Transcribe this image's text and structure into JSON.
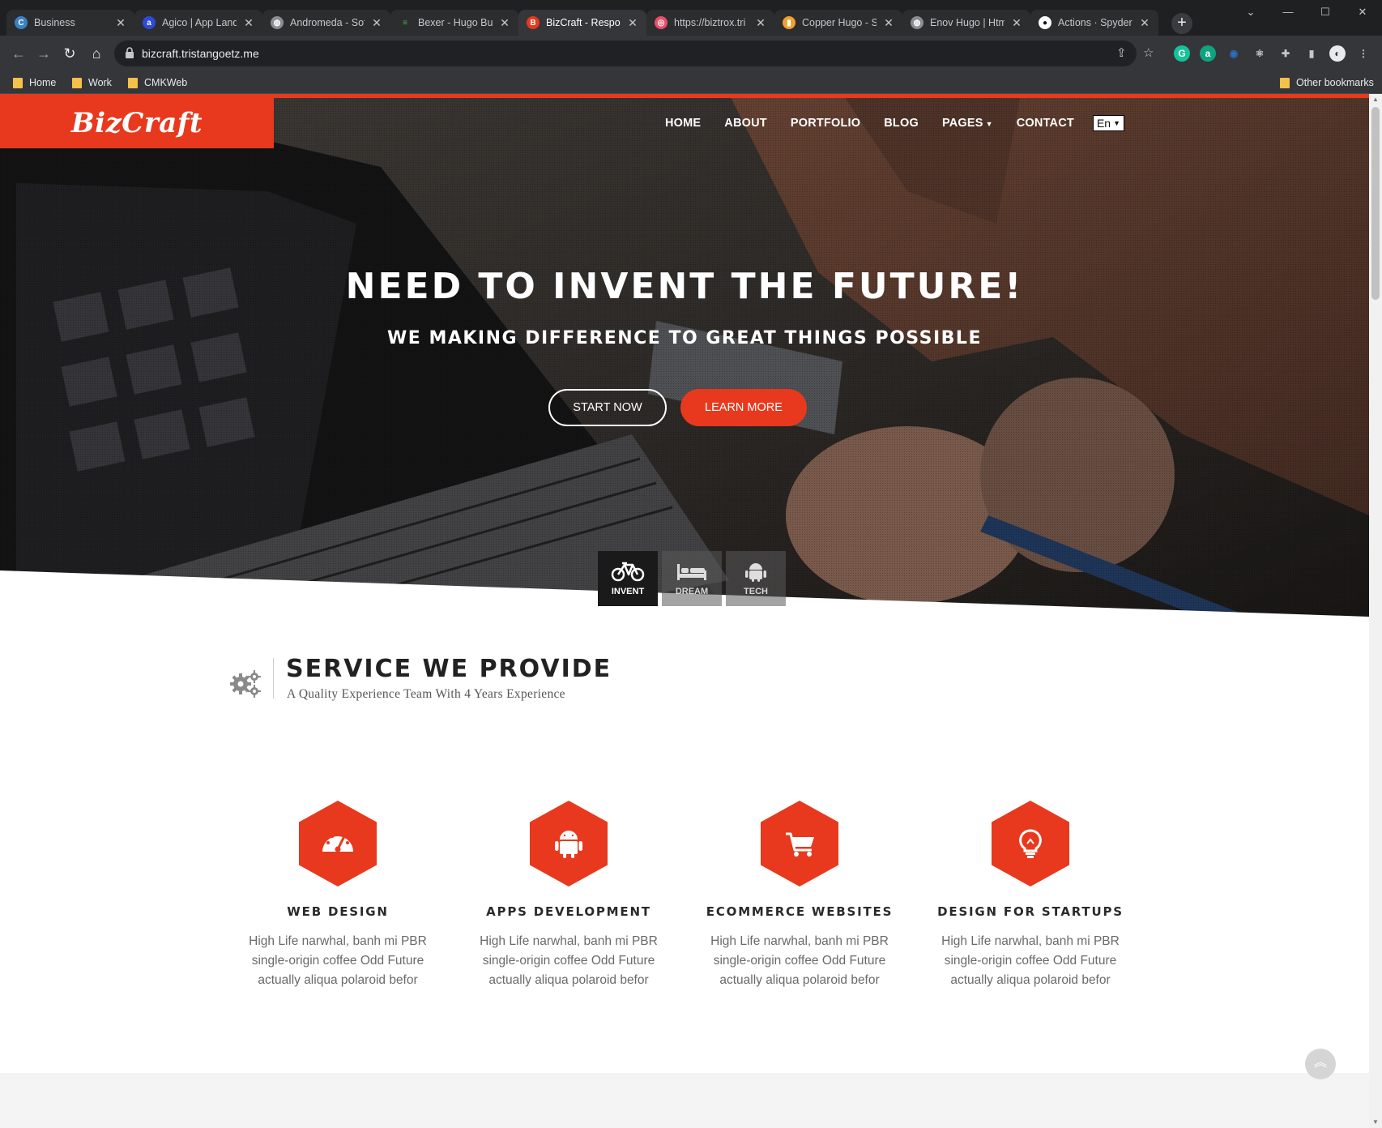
{
  "browser": {
    "tabs": [
      {
        "title": "Business",
        "favicon_color": "#3b82c4",
        "favicon_glyph": "C"
      },
      {
        "title": "Agico | App Landi",
        "favicon_color": "#2f4ad8",
        "favicon_glyph": "a"
      },
      {
        "title": "Andromeda - Soft",
        "favicon_color": "#8a8d91",
        "favicon_glyph": "◍"
      },
      {
        "title": "Bexer - Hugo Busi",
        "favicon_color": "#4caf50",
        "favicon_glyph": "≡"
      },
      {
        "title": "BizCraft - Respon",
        "favicon_color": "#e8391e",
        "favicon_glyph": "B"
      },
      {
        "title": "https://biztrox.tri",
        "favicon_color": "#e84f6a",
        "favicon_glyph": "◎"
      },
      {
        "title": "Copper Hugo - Si",
        "favicon_color": "#f2a12e",
        "favicon_glyph": "▮"
      },
      {
        "title": "Enov Hugo | Html",
        "favicon_color": "#8a8d91",
        "favicon_glyph": "◍"
      },
      {
        "title": "Actions · SpyderH",
        "favicon_color": "#ffffff",
        "favicon_glyph": "●"
      }
    ],
    "active_tab_index": 4,
    "url": "bizcraft.tristangoetz.me",
    "bookmarks": [
      {
        "label": "Home"
      },
      {
        "label": "Work"
      },
      {
        "label": "CMKWeb"
      }
    ],
    "other_bookmarks": "Other bookmarks"
  },
  "site": {
    "logo_text": "BizCraft",
    "accent_color": "#e8391e",
    "nav": [
      "HOME",
      "ABOUT",
      "PORTFOLIO",
      "BLOG",
      "PAGES",
      "CONTACT"
    ],
    "language": "En"
  },
  "hero": {
    "title": "NEED TO INVENT THE FUTURE!",
    "subtitle": "WE MAKING DIFFERENCE TO GREAT THINGS POSSIBLE",
    "primary_button": "START NOW",
    "secondary_button": "LEARN MORE",
    "slide_tabs": [
      {
        "label": "INVENT",
        "icon": "bicycle-icon",
        "active": true
      },
      {
        "label": "DREAM",
        "icon": "bed-icon",
        "active": false
      },
      {
        "label": "TECH",
        "icon": "android-icon",
        "active": false
      }
    ]
  },
  "services": {
    "title": "SERVICE WE PROVIDE",
    "subtitle": "A Quality Experience Team With 4 Years Experience",
    "items": [
      {
        "title": "WEB DESIGN",
        "icon": "dashboard-icon",
        "text": "High Life narwhal, banh mi PBR single-origin coffee Odd Future actually aliqua polaroid befor"
      },
      {
        "title": "APPS DEVELOPMENT",
        "icon": "android-icon",
        "text": "High Life narwhal, banh mi PBR single-origin coffee Odd Future actually aliqua polaroid befor"
      },
      {
        "title": "ECOMMERCE WEBSITES",
        "icon": "cart-icon",
        "text": "High Life narwhal, banh mi PBR single-origin coffee Odd Future actually aliqua polaroid befor"
      },
      {
        "title": "DESIGN FOR STARTUPS",
        "icon": "lightbulb-icon",
        "text": "High Life narwhal, banh mi PBR single-origin coffee Odd Future actually aliqua polaroid befor"
      }
    ]
  }
}
